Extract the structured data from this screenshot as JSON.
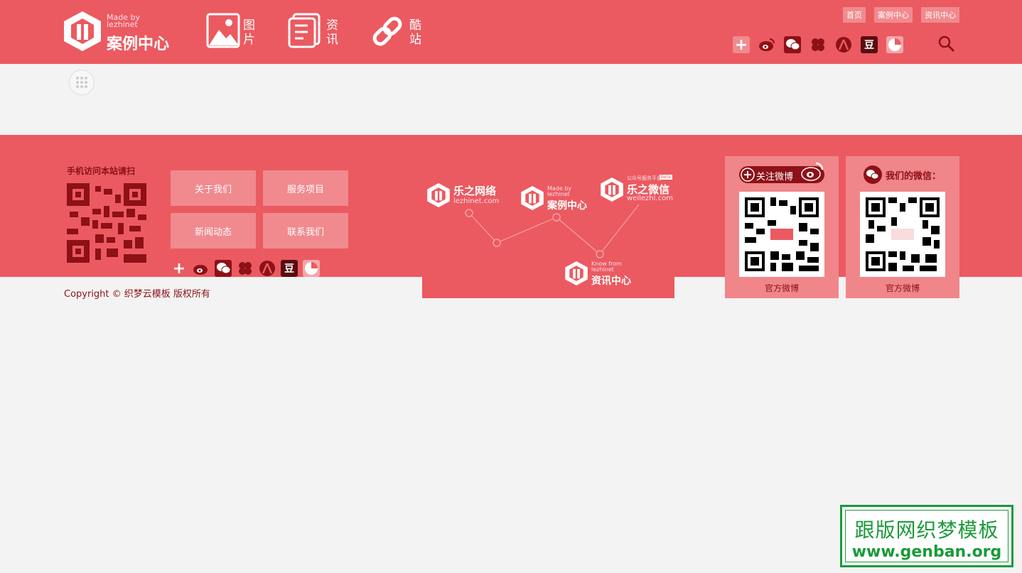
{
  "header": {
    "logo": {
      "made_by": "Made by",
      "lezhinet": "lezhinet",
      "title": "案例中心"
    },
    "nav": [
      {
        "label": "图片"
      },
      {
        "label": "资讯"
      },
      {
        "label": "酷站"
      }
    ],
    "top_links": [
      "首页",
      "案例中心",
      "资讯中心"
    ],
    "social_icons": [
      "plus-icon",
      "weibo-icon",
      "wechat-icon",
      "clover-icon",
      "renren-icon",
      "douban-icon",
      "circle-icon"
    ],
    "douban_glyph": "豆"
  },
  "footer": {
    "qr_title": "手机访问本站请扫",
    "links": [
      "关于我们",
      "服务项目",
      "新闻动态",
      "联系我们"
    ],
    "brands": [
      {
        "name": "乐之网络",
        "domain": "lezhinet.com"
      },
      {
        "made_by": "Made by",
        "lezhinet": "lezhinet",
        "name": "案例中心"
      },
      {
        "tag": "公众号服务平台",
        "beta": "beta",
        "name": "乐之微信",
        "domain": "weilezhi.com"
      },
      {
        "know_from": "Know from",
        "lezhinet": "lezhinet",
        "name": "资讯中心"
      }
    ],
    "weibo_card": {
      "title": "关注微博",
      "caption": "官方微博"
    },
    "wechat_card": {
      "title": "我们的微信：",
      "caption": "官方微博"
    },
    "copyright": "Copyright © 织梦云模板 版权所有"
  },
  "watermark": {
    "cn": "跟版网织梦模板",
    "en": "www.genban.org"
  },
  "colors": {
    "brand": "#eb5a60",
    "accent_dark": "#8d1117",
    "button": "#f08a8e",
    "stamp_green": "#1a9a3a"
  }
}
